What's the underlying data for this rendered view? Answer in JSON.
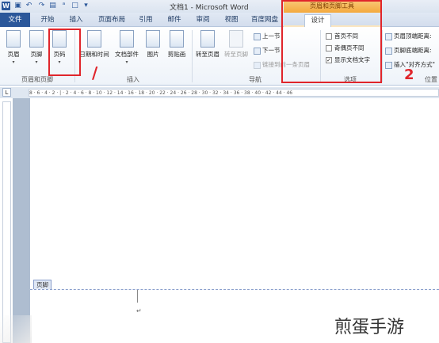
{
  "window": {
    "title": "文档1 - Microsoft Word",
    "contextual_title": "页眉和页脚工具"
  },
  "tabs": [
    "文件",
    "开始",
    "插入",
    "页面布局",
    "引用",
    "邮件",
    "审阅",
    "视图",
    "百度网盘",
    "设计"
  ],
  "ribbon": {
    "group_header_footer": {
      "label": "页眉和页脚",
      "header": "页眉",
      "footer": "页脚",
      "page_number": "页码"
    },
    "group_insert": {
      "label": "插入",
      "datetime": "日期和时间",
      "parts": "文档部件",
      "picture": "图片",
      "clipart": "剪贴画"
    },
    "group_nav": {
      "label": "导航",
      "goto_header": "转至页眉",
      "goto_footer": "转至页脚",
      "prev": "上一节",
      "next": "下一节",
      "link_prev": "链接到前一条页眉"
    },
    "group_options": {
      "label": "选项",
      "diff_first": "首页不同",
      "diff_odd_even": "奇偶页不同",
      "show_doc_text": "显示文档文字",
      "show_doc_text_checked": true
    },
    "group_position": {
      "label": "位置",
      "header_top": "页眉顶端距离:",
      "footer_bottom": "页脚底端距离:",
      "insert_align": "插入\"对齐方式\""
    }
  },
  "annotations": {
    "mark_one": "/",
    "mark_two": "2"
  },
  "ruler_text": "8 · 6 · 4 · 2 · | · 2 · 4 · 6 · 8 · 10 · 12 · 14 · 16 · 18 · 20 · 22 · 24 · 26 · 28 · 30 · 32 · 34 · 36 · 38 · 40 · 42 · 44 · 46",
  "document": {
    "footer_tag": "页脚",
    "paragraph_mark": "↵"
  },
  "watermark": "煎蛋手游"
}
